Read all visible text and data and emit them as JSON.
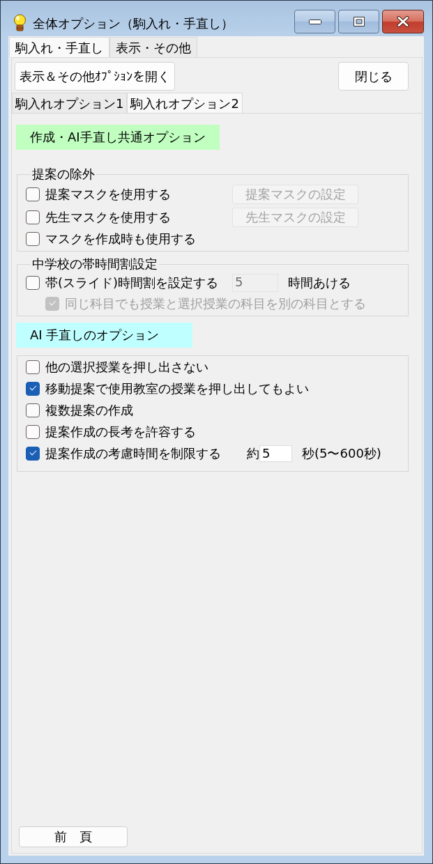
{
  "window": {
    "title": "全体オプション（駒入れ・手直し）"
  },
  "tabs": [
    {
      "label": "駒入れ・手直し",
      "selected": true
    },
    {
      "label": "表示・その他",
      "selected": false
    }
  ],
  "actions": [
    {
      "label": "表示＆その他ｵﾌﾟｼｮﾝを開く"
    },
    {
      "label": "閉じる"
    }
  ],
  "subtabs": [
    {
      "label": "駒入れオプション1",
      "selected": false
    },
    {
      "label": "駒入れオプション2",
      "selected": true
    }
  ],
  "sections": [
    {
      "heading": "作成・AI手直し共通オプション",
      "color": "#c0ffc0",
      "groups": [
        {
          "legend": "提案の除外",
          "rows": [
            {
              "label": "提案マスクを使用する",
              "checked": false,
              "disabled": false,
              "button": {
                "label": "提案マスクの設定",
                "disabled": true
              }
            },
            {
              "label": "先生マスクを使用する",
              "checked": false,
              "disabled": false,
              "button": {
                "label": "先生マスクの設定",
                "disabled": true
              }
            },
            {
              "label": "マスクを作成時も使用する",
              "checked": false,
              "disabled": false
            }
          ]
        },
        {
          "legend": "中学校の帯時間割設定",
          "rows": [
            {
              "label": "帯(スライド)時間割を設定する",
              "checked": false,
              "disabled": false,
              "field": {
                "value": "5",
                "disabled": true
              },
              "suffix": "時間あける",
              "children": [
                {
                  "label": "同じ科目でも授業と選択授業の科目を別の科目とする",
                  "checked": true,
                  "disabled": true
                }
              ]
            }
          ]
        }
      ]
    },
    {
      "heading": "AI 手直しのオプション",
      "color": "#c0ffff",
      "groups": [
        {
          "rows": [
            {
              "label": "他の選択授業を押し出さない",
              "checked": false,
              "disabled": false
            },
            {
              "label": "移動提案で使用教室の授業を押し出してもよい",
              "checked": true,
              "disabled": false
            },
            {
              "label": "複数提案の作成",
              "checked": false,
              "disabled": false
            },
            {
              "label": "提案作成の長考を許容する",
              "checked": false,
              "disabled": false
            },
            {
              "label": "提案作成の考慮時間を制限する",
              "checked": true,
              "disabled": false,
              "prefix": "約",
              "field": {
                "value": "5",
                "disabled": false
              },
              "suffix": "秒(5〜600秒)"
            }
          ]
        }
      ]
    }
  ],
  "footer_button": {
    "label": "前　頁"
  }
}
